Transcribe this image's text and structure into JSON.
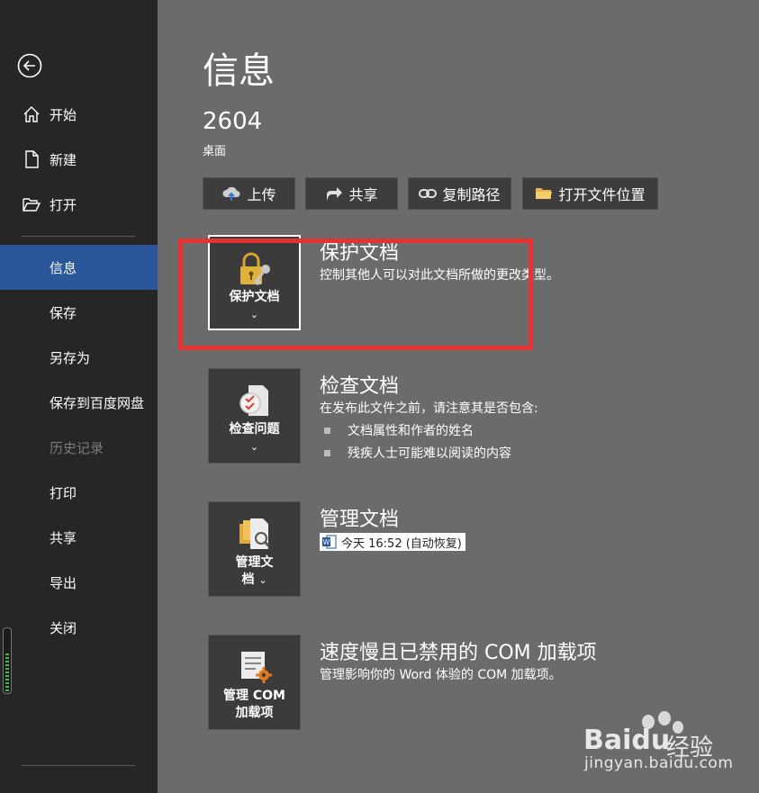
{
  "sidebar": {
    "back_icon": "back-arrow-icon",
    "items": [
      {
        "label": "开始",
        "icon": "home-icon"
      },
      {
        "label": "新建",
        "icon": "new-document-icon"
      },
      {
        "label": "打开",
        "icon": "open-folder-icon"
      },
      {
        "label": "信息",
        "active": true
      },
      {
        "label": "保存"
      },
      {
        "label": "另存为"
      },
      {
        "label": "保存到百度网盘"
      },
      {
        "label": "历史记录",
        "disabled": true
      },
      {
        "label": "打印"
      },
      {
        "label": "共享"
      },
      {
        "label": "导出"
      },
      {
        "label": "关闭"
      }
    ],
    "meter_level": 0.6
  },
  "main": {
    "title": "信息",
    "document_name": "2604",
    "document_location": "桌面",
    "actions": [
      {
        "label": "上传",
        "icon": "upload-cloud-icon"
      },
      {
        "label": "共享",
        "icon": "share-icon"
      },
      {
        "label": "复制路径",
        "icon": "link-icon"
      },
      {
        "label": "打开文件位置",
        "icon": "folder-icon"
      }
    ],
    "sections": {
      "protect": {
        "tile_label": "保护文档",
        "title": "保护文档",
        "description": "控制其他人可以对此文档所做的更改类型。"
      },
      "inspect": {
        "tile_label": "检查问题",
        "title": "检查文档",
        "description": "在发布此文件之前，请注意其是否包含:",
        "bullets": [
          "文档属性和作者的姓名",
          "残疾人士可能难以阅读的内容"
        ]
      },
      "manage": {
        "tile_label_line1": "管理文",
        "tile_label_line2": "档",
        "title": "管理文档",
        "version": "今天 16:52 (自动恢复)"
      },
      "com": {
        "tile_label_line1": "管理 COM",
        "tile_label_line2": "加载项",
        "title": "速度慢且已禁用的 COM 加载项",
        "description": "管理影响你的 Word 体验的 COM 加载项。"
      }
    },
    "chevron": "⌄"
  },
  "watermark": {
    "brand": "Baidu",
    "cn": "经验",
    "url": "jingyan.baidu.com"
  },
  "colors": {
    "sidebar_bg": "#262626",
    "main_bg": "#6b6b6b",
    "active_item": "#2b579a",
    "highlight": "#e83131"
  }
}
